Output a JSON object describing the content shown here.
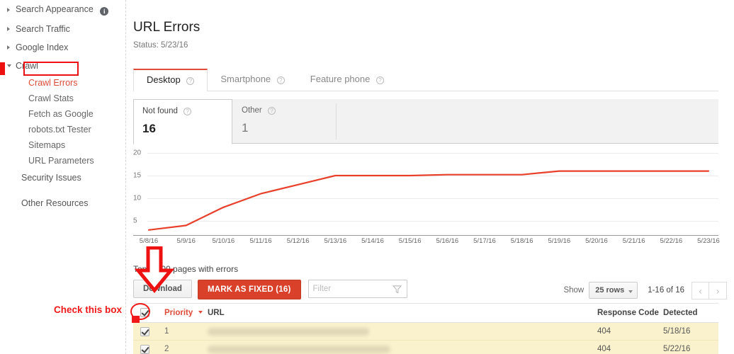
{
  "sidebar": {
    "top_items": [
      {
        "label": "Search Appearance",
        "caret": "caret-right-icon",
        "info": true
      },
      {
        "label": "Search Traffic",
        "caret": "caret-right-icon",
        "info": false
      },
      {
        "label": "Google Index",
        "caret": "caret-right-icon",
        "info": false
      },
      {
        "label": "Crawl",
        "caret": "caret-down-icon",
        "info": false
      }
    ],
    "crawl_children": [
      "Crawl Errors",
      "Crawl Stats",
      "Fetch as Google",
      "robots.txt Tester",
      "Sitemaps",
      "URL Parameters"
    ],
    "security_issues": "Security Issues",
    "other_resources": "Other Resources"
  },
  "header": {
    "title": "URL Errors",
    "status": "Status: 5/23/16"
  },
  "tabs": [
    {
      "label": "Desktop",
      "active": true
    },
    {
      "label": "Smartphone",
      "active": false
    },
    {
      "label": "Feature phone",
      "active": false
    }
  ],
  "cards": [
    {
      "label": "Not found",
      "value": "16",
      "active": true
    },
    {
      "label": "Other",
      "value": "1",
      "active": false
    }
  ],
  "chart_data": {
    "type": "line",
    "title": "",
    "xlabel": "",
    "ylabel": "",
    "grid": true,
    "legend": false,
    "ylim": [
      0,
      22
    ],
    "yticks": [
      5,
      10,
      15,
      20
    ],
    "line_color": "#e8402a",
    "x": [
      "5/8/16",
      "5/9/16",
      "5/10/16",
      "5/11/16",
      "5/12/16",
      "5/13/16",
      "5/14/16",
      "5/15/16",
      "5/16/16",
      "5/17/16",
      "5/18/16",
      "5/19/16",
      "5/20/16",
      "5/21/16",
      "5/22/16",
      "5/23/16"
    ],
    "series": [
      {
        "name": "Not found errors",
        "values": [
          3,
          4,
          8,
          11,
          13,
          15,
          15,
          15,
          15.2,
          15.2,
          15.2,
          16,
          16,
          16,
          16,
          16
        ]
      }
    ]
  },
  "toolbar": {
    "top_pages_label": "Top 1,000 pages with errors",
    "download_label": "Download",
    "mark_fixed_label": "MARK AS FIXED (16)",
    "filter_placeholder": "Filter",
    "show_label": "Show",
    "rows_value": "25 rows",
    "range_label": "1-16 of 16"
  },
  "table": {
    "columns": [
      "Priority",
      "URL",
      "Response Code",
      "Detected"
    ],
    "rows": [
      {
        "priority": "1",
        "url": "",
        "code": "404",
        "detected": "5/18/16",
        "checked": true,
        "url_blur_width": 228
      },
      {
        "priority": "2",
        "url": "",
        "code": "404",
        "detected": "5/22/16",
        "checked": true,
        "url_blur_width": 258
      }
    ]
  },
  "annotations": {
    "check_this_box": "Check this box",
    "arrow_color": "#ee1111",
    "highlight_color": "#f01818"
  }
}
